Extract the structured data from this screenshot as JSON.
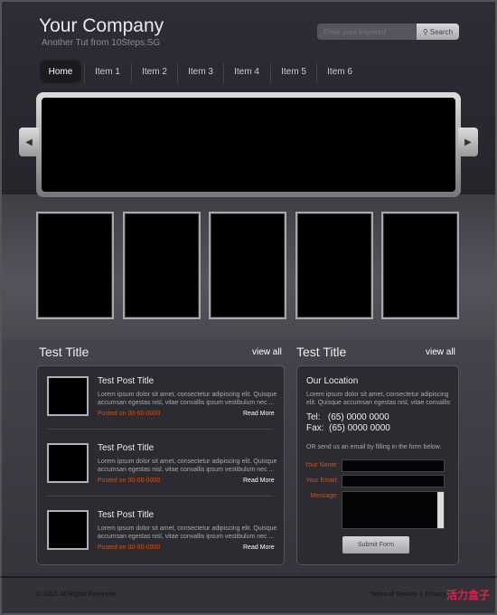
{
  "header": {
    "logo": "Your Company",
    "tagline": "Another Tut from 10Steps.SG",
    "search": {
      "placeholder": "Enter your keyword",
      "button": "Search",
      "icon": "search-icon"
    }
  },
  "nav": {
    "items": [
      "Home",
      "Item 1",
      "Item 2",
      "Item 3",
      "Item 4",
      "Item 5",
      "Item 6"
    ],
    "active": "Home"
  },
  "slider": {
    "prev_icon": "arrow-left-icon",
    "next_icon": "arrow-right-icon"
  },
  "left": {
    "title": "Test Title",
    "view_all": "view all",
    "posts": [
      {
        "title": "Test Post Title",
        "body": "Lorem ipsum dolor sit amet, consectetur adipiscing elit. Quisque accumsan egestas nisl, vitae convallis ipsum vestibulum nec ...",
        "date": "Posted on 00-00-0000",
        "read_more": "Read More"
      },
      {
        "title": "Test Post Title",
        "body": "Lorem ipsum dolor sit amet, consectetur adipiscing elit. Quisque accumsan egestas nisl, vitae convallis ipsum vestibulum nec ...",
        "date": "Posted on 00-00-0000",
        "read_more": "Read More"
      },
      {
        "title": "Test Post Title",
        "body": "Lorem ipsum dolor sit amet, consectetur adipiscing elit. Quisque accumsan egestas nisl, vitae convallis ipsum vestibulum nec ...",
        "date": "Posted on 00-00-0000",
        "read_more": "Read More"
      }
    ]
  },
  "right": {
    "title": "Test Title",
    "view_all": "view all",
    "heading": "Our Location",
    "body": "Lorem ipsum dolor sit amet, consectetur adipiscing elit. Quisque accumsan egestas nisl, vitae convallis",
    "tel": "Tel:   (65) 0000 0000",
    "fax": "Fax:  (65) 0000 0000",
    "form_intro": "OR send us an email by filling in the form below.",
    "name_label": "Your Name:",
    "email_label": "Your Email:",
    "message_label": "Message:",
    "submit": "Submit Form"
  },
  "footer": {
    "copyright": "© 2010. All Rights Reserved.",
    "links": "Terms of Service  |  Privacy",
    "watermark": "活力盒子"
  },
  "colors": {
    "accent": "#c7561a",
    "background": "#2b2a31"
  }
}
